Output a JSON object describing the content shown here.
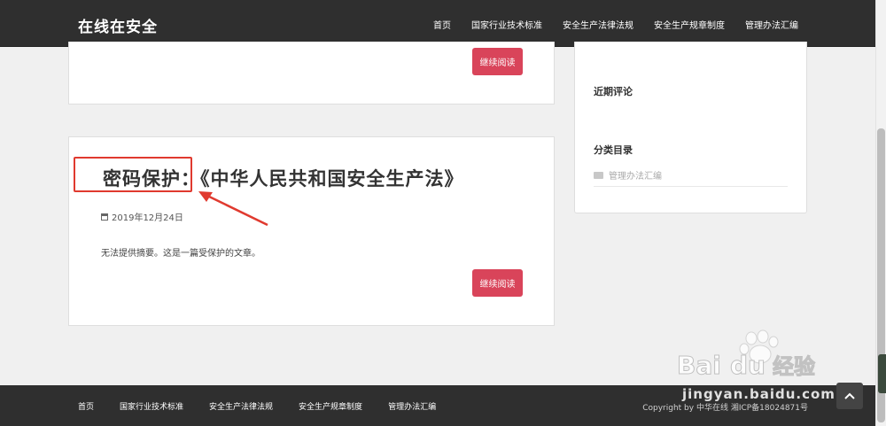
{
  "site": {
    "brand": "在线在安全"
  },
  "nav": {
    "items": [
      "首页",
      "国家行业技术标准",
      "安全生产法律法规",
      "安全生产规章制度",
      "管理办法汇编"
    ]
  },
  "posts": {
    "prev": {
      "read_more": "继续阅读"
    },
    "current": {
      "title": "密码保护：《中华人民共和国安全生产法》",
      "date": "2019年12月24日",
      "excerpt": "无法提供摘要。这是一篇受保护的文章。",
      "read_more": "继续阅读"
    }
  },
  "sidebar": {
    "recent_comments_heading": "近期评论",
    "categories_heading": "分类目录",
    "categories": [
      "管理办法汇编"
    ]
  },
  "footer": {
    "nav": [
      "首页",
      "国家行业技术标准",
      "安全生产法律法规",
      "安全生产规章制度",
      "管理办法汇编"
    ],
    "copyright": "Copyright by 中华在线  湘ICP备18024871号"
  },
  "watermark": {
    "text": "jingyan.baidu.com",
    "logo": "Bai du 经验"
  },
  "colors": {
    "header_bg": "#2f2f2f",
    "button": "#d9445a",
    "annotation": "#e03a2f"
  }
}
